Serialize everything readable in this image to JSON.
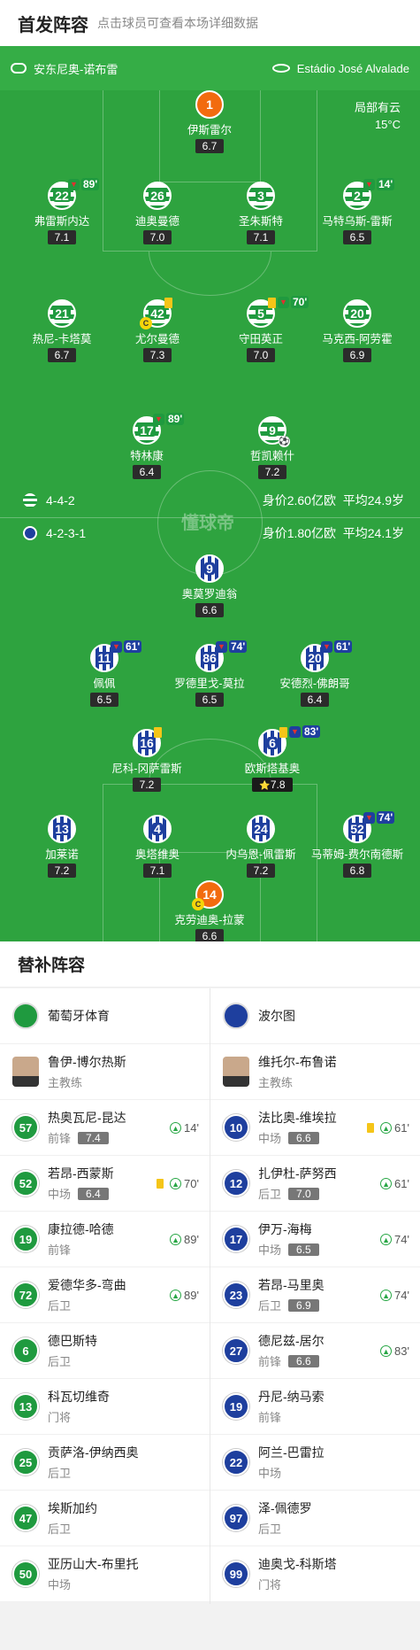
{
  "header": {
    "title": "首发阵容",
    "subtitle": "点击球员可查看本场详细数据"
  },
  "match": {
    "referee": "安东尼奥-诺布雷",
    "stadium": "Estádio José Alvalade",
    "weather": "局部有云",
    "temp": "15°C"
  },
  "home": {
    "formation": "4-4-2",
    "value": "身价2.60亿欧",
    "avg_age": "平均24.9岁"
  },
  "away": {
    "formation": "4-2-3-1",
    "value": "身价1.80亿欧",
    "avg_age": "平均24.1岁"
  },
  "watermark": "懂球帝",
  "players": [
    {
      "num": "1",
      "name": "伊斯雷尔",
      "rating": "6.7",
      "team": "gk"
    },
    {
      "num": "22",
      "name": "弗雷斯内达",
      "rating": "7.1",
      "team": "sp",
      "sub": "89'"
    },
    {
      "num": "26",
      "name": "迪奥曼德",
      "rating": "7.0",
      "team": "sp"
    },
    {
      "num": "3",
      "name": "圣朱斯特",
      "rating": "7.1",
      "team": "sp"
    },
    {
      "num": "2",
      "name": "马特乌斯-雷斯",
      "rating": "6.5",
      "team": "sp",
      "sub": "14'"
    },
    {
      "num": "21",
      "name": "热尼-卡塔莫",
      "rating": "6.7",
      "team": "sp"
    },
    {
      "num": "42",
      "name": "尤尔曼德",
      "rating": "7.3",
      "team": "sp",
      "yellow": true,
      "captain": true
    },
    {
      "num": "5",
      "name": "守田英正",
      "rating": "7.0",
      "team": "sp",
      "yellow": true,
      "sub": "70'"
    },
    {
      "num": "20",
      "name": "马克西-阿劳霍",
      "rating": "6.9",
      "team": "sp"
    },
    {
      "num": "17",
      "name": "特林康",
      "rating": "6.4",
      "team": "sp",
      "sub": "89'"
    },
    {
      "num": "9",
      "name": "哲凯赖什",
      "rating": "7.2",
      "team": "sp",
      "goal": true
    },
    {
      "num": "9",
      "name": "奥莫罗迪翁",
      "rating": "6.6",
      "team": "po"
    },
    {
      "num": "11",
      "name": "佩佩",
      "rating": "6.5",
      "team": "po",
      "sub": "61'"
    },
    {
      "num": "86",
      "name": "罗德里戈-莫拉",
      "rating": "6.5",
      "team": "po",
      "sub": "74'"
    },
    {
      "num": "20",
      "name": "安德烈-佛朗哥",
      "rating": "6.4",
      "team": "po",
      "sub": "61'"
    },
    {
      "num": "16",
      "name": "尼科-冈萨雷斯",
      "rating": "7.2",
      "team": "po",
      "yellow": true
    },
    {
      "num": "6",
      "name": "欧斯塔基奥",
      "rating": "7.8",
      "team": "po",
      "yellow": true,
      "sub": "83'",
      "best": true
    },
    {
      "num": "13",
      "name": "加莱诺",
      "rating": "7.2",
      "team": "po"
    },
    {
      "num": "4",
      "name": "奥塔维奥",
      "rating": "7.1",
      "team": "po"
    },
    {
      "num": "24",
      "name": "内乌恩-佩雷斯",
      "rating": "7.2",
      "team": "po"
    },
    {
      "num": "52",
      "name": "马蒂姆-费尔南德斯",
      "rating": "6.8",
      "team": "po",
      "sub": "74'"
    },
    {
      "num": "14",
      "name": "克劳迪奥-拉蒙",
      "rating": "6.6",
      "team": "gk",
      "captain": true
    }
  ],
  "subs_title": "替补阵容",
  "bench": {
    "home": {
      "team": "葡萄牙体育",
      "coach": "鲁伊-博尔热斯",
      "coach_role": "主教练",
      "color": "#1f9a3f",
      "list": [
        {
          "num": "57",
          "name": "热奥瓦尼-昆达",
          "pos": "前锋",
          "rating": "7.4",
          "in": "14'"
        },
        {
          "num": "52",
          "name": "若昂-西蒙斯",
          "pos": "中场",
          "rating": "6.4",
          "in": "70'",
          "yellow": true
        },
        {
          "num": "19",
          "name": "康拉德-哈德",
          "pos": "前锋",
          "in": "89'"
        },
        {
          "num": "72",
          "name": "爱德华多-弯曲",
          "pos": "后卫",
          "in": "89'"
        },
        {
          "num": "6",
          "name": "德巴斯特",
          "pos": "后卫"
        },
        {
          "num": "13",
          "name": "科瓦切维奇",
          "pos": "门将"
        },
        {
          "num": "25",
          "name": "贡萨洛-伊纳西奥",
          "pos": "后卫"
        },
        {
          "num": "47",
          "name": "埃斯加约",
          "pos": "后卫"
        },
        {
          "num": "50",
          "name": "亚历山大-布里托",
          "pos": "中场"
        }
      ]
    },
    "away": {
      "team": "波尔图",
      "coach": "维托尔-布鲁诺",
      "coach_role": "主教练",
      "color": "#1e3f9e",
      "list": [
        {
          "num": "10",
          "name": "法比奥-维埃拉",
          "pos": "中场",
          "rating": "6.6",
          "in": "61'",
          "yellow": true
        },
        {
          "num": "12",
          "name": "扎伊杜-萨努西",
          "pos": "后卫",
          "rating": "7.0",
          "in": "61'"
        },
        {
          "num": "17",
          "name": "伊万-海梅",
          "pos": "中场",
          "rating": "6.5",
          "in": "74'"
        },
        {
          "num": "23",
          "name": "若昂-马里奥",
          "pos": "后卫",
          "rating": "6.9",
          "in": "74'"
        },
        {
          "num": "27",
          "name": "德尼兹-居尔",
          "pos": "前锋",
          "rating": "6.6",
          "in": "83'"
        },
        {
          "num": "19",
          "name": "丹尼-纳马索",
          "pos": "前锋"
        },
        {
          "num": "22",
          "name": "阿兰-巴雷拉",
          "pos": "中场"
        },
        {
          "num": "97",
          "name": "泽-佩德罗",
          "pos": "后卫"
        },
        {
          "num": "99",
          "name": "迪奥戈-科斯塔",
          "pos": "门将"
        }
      ]
    }
  }
}
